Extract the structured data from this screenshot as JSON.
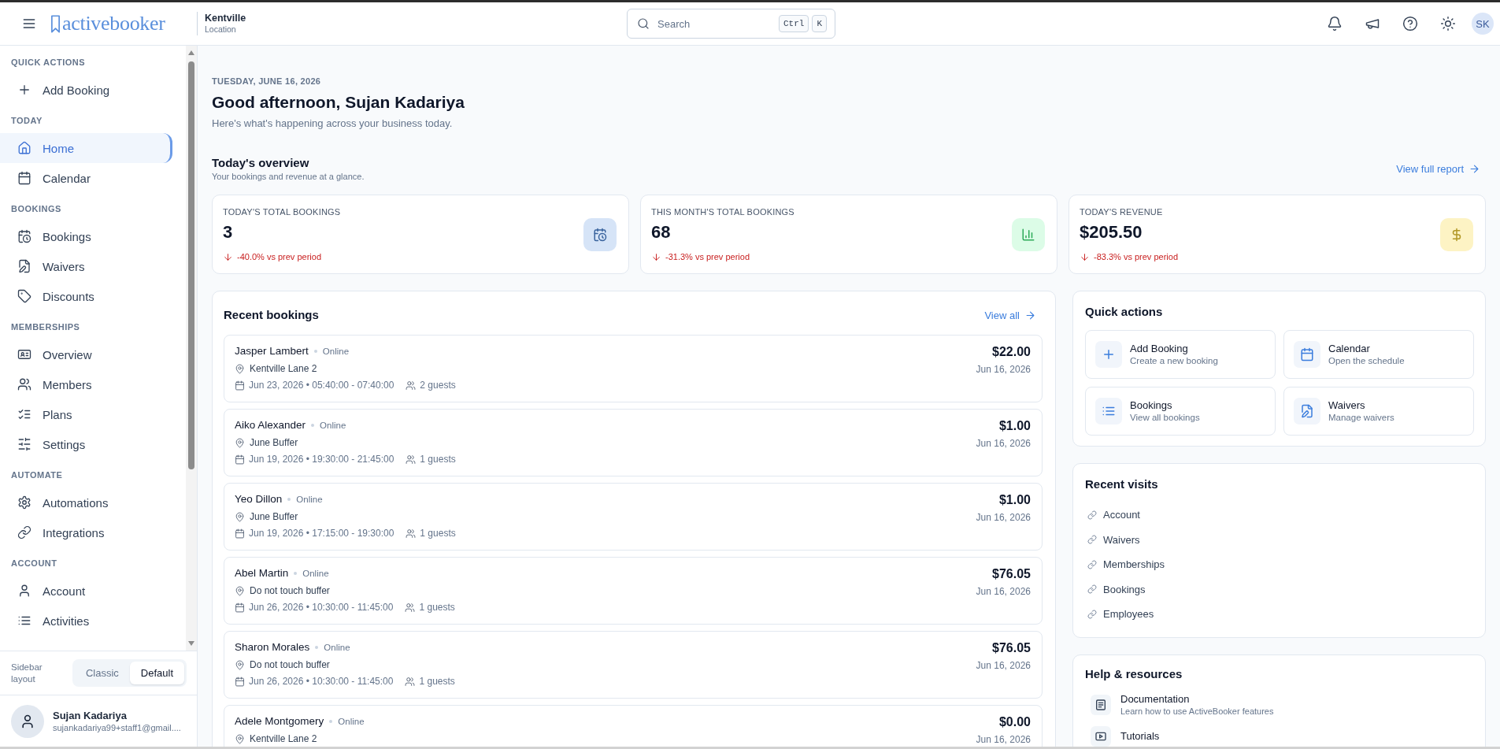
{
  "header": {
    "logo": "activebooker",
    "location": {
      "name": "Kentville",
      "label": "Location"
    },
    "search": {
      "placeholder": "Search",
      "shortcut": [
        "Ctrl",
        "K"
      ]
    },
    "avatar": "SK"
  },
  "sidebar": {
    "sections": [
      {
        "title": "QUICK ACTIONS",
        "items": [
          {
            "label": "Add Booking",
            "selected": false
          }
        ]
      },
      {
        "title": "TODAY",
        "items": [
          {
            "label": "Home",
            "selected": true
          },
          {
            "label": "Calendar",
            "selected": false
          }
        ]
      },
      {
        "title": "BOOKINGS",
        "items": [
          {
            "label": "Bookings",
            "selected": false
          },
          {
            "label": "Waivers",
            "selected": false
          },
          {
            "label": "Discounts",
            "selected": false
          }
        ]
      },
      {
        "title": "MEMBERSHIPS",
        "items": [
          {
            "label": "Overview",
            "selected": false
          },
          {
            "label": "Members",
            "selected": false
          },
          {
            "label": "Plans",
            "selected": false
          },
          {
            "label": "Settings",
            "selected": false
          }
        ]
      },
      {
        "title": "AUTOMATE",
        "items": [
          {
            "label": "Automations",
            "selected": false
          },
          {
            "label": "Integrations",
            "selected": false
          }
        ]
      },
      {
        "title": "ACCOUNT",
        "items": [
          {
            "label": "Account",
            "selected": false
          },
          {
            "label": "Activities",
            "selected": false
          }
        ]
      }
    ],
    "layout_switch": {
      "label": "Sidebar layout",
      "options": [
        {
          "label": "Classic",
          "selected": false
        },
        {
          "label": "Default",
          "selected": true
        }
      ]
    },
    "user": {
      "name": "Sujan Kadariya",
      "email": "sujankadariya99+staff1@gmail...."
    }
  },
  "page": {
    "date": "TUESDAY, JUNE 16, 2026",
    "greeting": "Good afternoon, Sujan Kadariya",
    "subtitle": "Here's what's happening across your business today."
  },
  "overview": {
    "title": "Today's overview",
    "subtitle": "Your bookings and revenue at a glance.",
    "link": "View full report",
    "stats": [
      {
        "label": "TODAY'S TOTAL BOOKINGS",
        "value": "3",
        "change": "-40.0% vs prev period",
        "color": "#d6e4f7"
      },
      {
        "label": "THIS MONTH'S TOTAL BOOKINGS",
        "value": "68",
        "change": "-31.3% vs prev period",
        "color": "#dcfce7"
      },
      {
        "label": "TODAY'S REVENUE",
        "value": "$205.50",
        "change": "-83.3% vs prev period",
        "color": "#fdf3c4"
      }
    ]
  },
  "recent_bookings": {
    "title": "Recent bookings",
    "link": "View all",
    "items": [
      {
        "name": "Jasper Lambert",
        "source": "Online",
        "location": "Kentville Lane 2",
        "when": "Jun 23, 2026 • 05:40:00 - 07:40:00",
        "guests": "2 guests",
        "price": "$22.00",
        "date": "Jun 16, 2026"
      },
      {
        "name": "Aiko Alexander",
        "source": "Online",
        "location": "June Buffer",
        "when": "Jun 19, 2026 • 19:30:00 - 21:45:00",
        "guests": "1 guests",
        "price": "$1.00",
        "date": "Jun 16, 2026"
      },
      {
        "name": "Yeo Dillon",
        "source": "Online",
        "location": "June Buffer",
        "when": "Jun 19, 2026 • 17:15:00 - 19:30:00",
        "guests": "1 guests",
        "price": "$1.00",
        "date": "Jun 16, 2026"
      },
      {
        "name": "Abel Martin",
        "source": "Online",
        "location": "Do not touch buffer",
        "when": "Jun 26, 2026 • 10:30:00 - 11:45:00",
        "guests": "1 guests",
        "price": "$76.05",
        "date": "Jun 16, 2026"
      },
      {
        "name": "Sharon Morales",
        "source": "Online",
        "location": "Do not touch buffer",
        "when": "Jun 26, 2026 • 10:30:00 - 11:45:00",
        "guests": "1 guests",
        "price": "$76.05",
        "date": "Jun 16, 2026"
      },
      {
        "name": "Adele Montgomery",
        "source": "Online",
        "location": "Kentville Lane 2",
        "price": "$0.00",
        "date": "Jun 16, 2026"
      }
    ]
  },
  "quick_actions": {
    "title": "Quick actions",
    "items": [
      {
        "title": "Add Booking",
        "subtitle": "Create a new booking"
      },
      {
        "title": "Calendar",
        "subtitle": "Open the schedule"
      },
      {
        "title": "Bookings",
        "subtitle": "View all bookings"
      },
      {
        "title": "Waivers",
        "subtitle": "Manage waivers"
      }
    ]
  },
  "recent_visits": {
    "title": "Recent visits",
    "items": [
      "Account",
      "Waivers",
      "Memberships",
      "Bookings",
      "Employees"
    ]
  },
  "help": {
    "title": "Help & resources",
    "items": [
      {
        "title": "Documentation",
        "subtitle": "Learn how to use ActiveBooker features"
      },
      {
        "title": "Tutorials"
      }
    ]
  }
}
